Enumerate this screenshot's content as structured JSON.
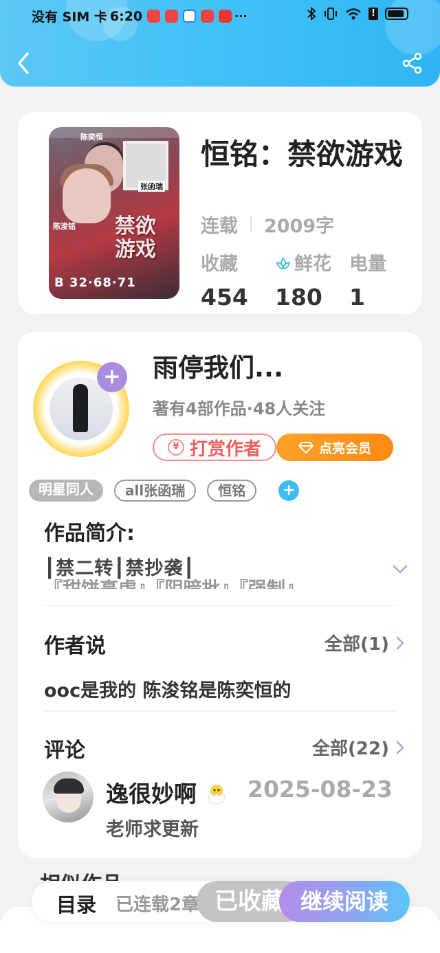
{
  "status_bar": {
    "carrier": "没有 SIM 卡",
    "time": "6:20",
    "more": "···"
  },
  "header": {
    "back_icon": "chevron-left-icon",
    "share_icon": "share-icon"
  },
  "book": {
    "cover": {
      "name_top": "陈奕恒",
      "name_left": "陈浚铭",
      "name_right": "张函瑞",
      "title_line1": "禁欲",
      "title_line2": "游戏",
      "number": "B 32·68·71"
    },
    "title": "恒铭：禁欲游戏",
    "status": "连载",
    "word_count": "2009字",
    "stats": [
      {
        "label": "收藏",
        "value": "454"
      },
      {
        "label": "鲜花",
        "value": "180",
        "icon": "flower-icon"
      },
      {
        "label": "电量",
        "value": "1"
      }
    ]
  },
  "author": {
    "name": "雨停我们...",
    "meta": "著有4部作品·48人关注",
    "follow_label": "+",
    "reward_label": "打赏作者",
    "reward_icon_text": "¥",
    "vip_label": "点亮会员"
  },
  "tags": [
    "明星同人",
    "all张函瑞",
    "恒铭"
  ],
  "tag_add": "+",
  "intro": {
    "title": "作品简介:",
    "line1": "┃禁二转┃禁抄袭┃",
    "line2": "『甜饼高虐』『阴暗批』『强制』"
  },
  "author_say": {
    "title": "作者说",
    "all_label": "全部(1)",
    "content": "ooc是我的 陈浚铭是陈奕恒的"
  },
  "comments": {
    "title": "评论",
    "all_label": "全部(22)",
    "items": [
      {
        "user": "逸很妙啊",
        "date": "2025-08-23",
        "text": "老师求更新"
      }
    ]
  },
  "similar_title": "相似作品",
  "bottom_bar": {
    "catalog": "目录",
    "progress": "已连载2章",
    "favorited": "已收藏",
    "continue": "继续阅读"
  },
  "colors": {
    "header": "#41c1f6",
    "accent_purple": "#a98ee0",
    "reward_red": "#ef5d5d",
    "vip_orange": "#ff8a14"
  }
}
